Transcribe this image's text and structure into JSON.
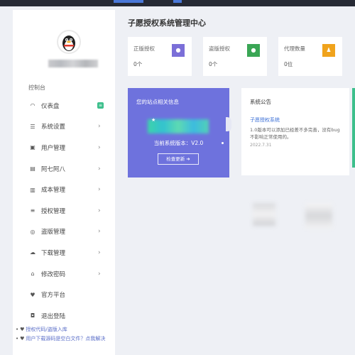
{
  "header": {
    "page_title": "子愿授权系统管理中心"
  },
  "sidebar": {
    "section_label": "控制台",
    "items": [
      {
        "icon": "dashboard-icon",
        "glyph": "◠",
        "label": "仪表盘",
        "badge": "≡"
      },
      {
        "icon": "settings-list-icon",
        "glyph": "☰",
        "label": "系统设置",
        "arrow": "›"
      },
      {
        "icon": "user-icon",
        "glyph": "▣",
        "label": "用户管理",
        "arrow": "›"
      },
      {
        "icon": "calendar-icon",
        "glyph": "▤",
        "label": "阿七阿八",
        "arrow": "›"
      },
      {
        "icon": "card-icon",
        "glyph": "▥",
        "label": "成本管理",
        "arrow": "›"
      },
      {
        "icon": "list-icon",
        "glyph": "≡",
        "label": "授权管理",
        "arrow": "›"
      },
      {
        "icon": "target-icon",
        "glyph": "◎",
        "label": "盗版管理",
        "arrow": "›"
      },
      {
        "icon": "cloud-download-icon",
        "glyph": "☁",
        "label": "下载管理",
        "arrow": "›"
      },
      {
        "icon": "lock-icon",
        "glyph": "⌂",
        "label": "修改密码",
        "arrow": "›"
      },
      {
        "icon": "heart-icon",
        "glyph": "♥",
        "label": "官方平台"
      },
      {
        "icon": "logout-icon",
        "glyph": "◘",
        "label": "退出登陆"
      }
    ],
    "footer": {
      "link1": "授权代码/盗版入库",
      "link2": "用户下载源码是空白文件？点我解决"
    }
  },
  "stats": [
    {
      "label": "正版授权",
      "value": "0个",
      "color": "#7b6fd8",
      "icon": "info-icon",
      "glyph": "●"
    },
    {
      "label": "盗版授权",
      "value": "0个",
      "color": "#3aa655",
      "icon": "shield-icon",
      "glyph": "●"
    },
    {
      "label": "代理数量",
      "value": "0位",
      "color": "#f0a31c",
      "icon": "person-icon",
      "glyph": "♟"
    }
  ],
  "info_card": {
    "title": "您的站点相关信息",
    "version": "当前系统版本：V2.0",
    "check_update": "检查更新 ➜"
  },
  "notice": {
    "title": "系统公告",
    "link": "子愿授权系统",
    "body": "1.0版本可以添加已经差不多完善，没有bug不影响正常使用的。",
    "date": "2022.7.31"
  },
  "colors": {
    "sidebar_bg": "#ffffff",
    "topbar_bg": "#262a35",
    "info_card_bg": "#6e72dd",
    "badge_green": "#3dbf8c"
  }
}
